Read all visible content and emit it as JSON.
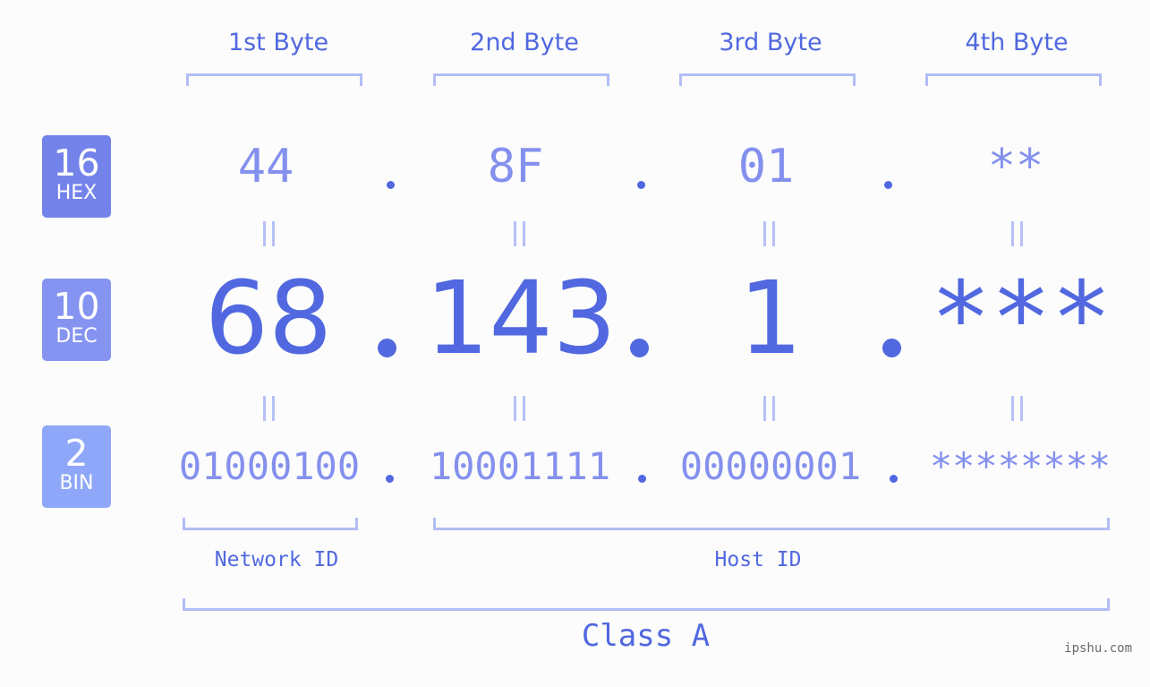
{
  "bytes": [
    {
      "label": "1st Byte",
      "hex": "44",
      "dec": "68",
      "bin": "01000100"
    },
    {
      "label": "2nd Byte",
      "hex": "8F",
      "dec": "143",
      "bin": "10001111"
    },
    {
      "label": "3rd Byte",
      "hex": "01",
      "dec": "1",
      "bin": "00000001"
    },
    {
      "label": "4th Byte",
      "hex": "**",
      "dec": "***",
      "bin": "********"
    }
  ],
  "bases": [
    {
      "number": "16",
      "name": "HEX",
      "color": "#7383ea"
    },
    {
      "number": "10",
      "name": "DEC",
      "color": "#8494f0"
    },
    {
      "number": "2",
      "name": "BIN",
      "color": "#8fa7f8"
    }
  ],
  "separator": ".",
  "network_id_label": "Network ID",
  "host_id_label": "Host ID",
  "class_label": "Class A",
  "watermark": "ipshu.com",
  "colors": {
    "accent": "#5168e0",
    "light_value": "#8490ee",
    "bracket": "#b2bdf6",
    "background": "#fbfcfb"
  }
}
